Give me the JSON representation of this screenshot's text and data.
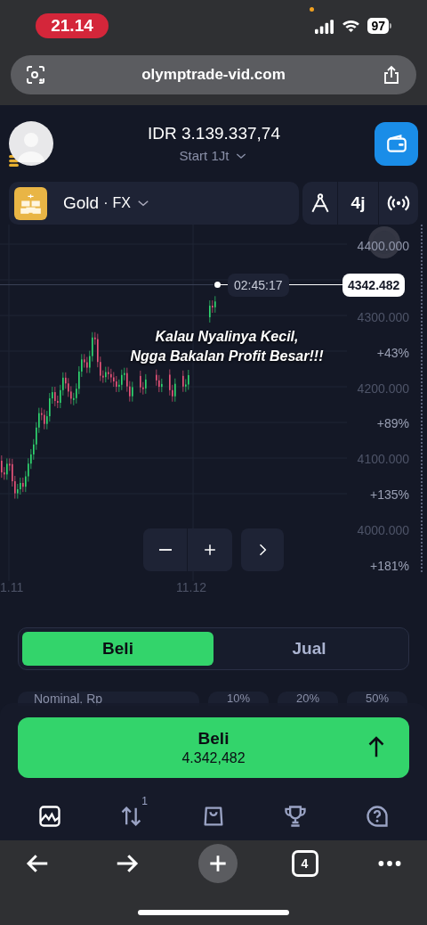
{
  "status_bar": {
    "time": "21.14",
    "battery": "97"
  },
  "browser": {
    "url": "olymptrade-vid.com",
    "tab_count": "4"
  },
  "account": {
    "balance": "IDR 3.139.337,74",
    "account_name": "Start 1Jt"
  },
  "instrument": {
    "name": "Gold",
    "separator": "·",
    "market": "FX",
    "timeframe": "4j"
  },
  "chart": {
    "current_price": "4342.482",
    "countdown": "02:45:17",
    "axis_labels": [
      {
        "text": "4400.000",
        "kind": "price"
      },
      {
        "text": "4300.000",
        "kind": "price"
      },
      {
        "text": "+43%",
        "kind": "percent"
      },
      {
        "text": "4200.000",
        "kind": "price"
      },
      {
        "text": "+89%",
        "kind": "percent"
      },
      {
        "text": "4100.000",
        "kind": "price"
      },
      {
        "text": "+135%",
        "kind": "percent"
      },
      {
        "text": "4000.000",
        "kind": "price"
      },
      {
        "text": "+181%",
        "kind": "percent"
      }
    ],
    "date_labels": [
      "1.11",
      "11.12"
    ],
    "caption": [
      "Kalau Nyalinya Kecil,",
      "Ngga Bakalan Profit Besar!!!"
    ]
  },
  "trade_tabs": [
    {
      "label": "Beli",
      "selected": true
    },
    {
      "label": "Jual",
      "selected": false
    }
  ],
  "amount_field": {
    "placeholder": "Nominal, Rp"
  },
  "percent_buttons": [
    "10%",
    "20%",
    "50%"
  ],
  "buy_button": {
    "label": "Beli",
    "price": "4.342,482"
  },
  "bottom_nav": [
    {
      "kind": "chart",
      "selected": true
    },
    {
      "kind": "trades",
      "selected": false,
      "badge": "1"
    },
    {
      "kind": "shop",
      "selected": false
    },
    {
      "kind": "trophy",
      "selected": false
    },
    {
      "kind": "help",
      "selected": false
    }
  ]
}
